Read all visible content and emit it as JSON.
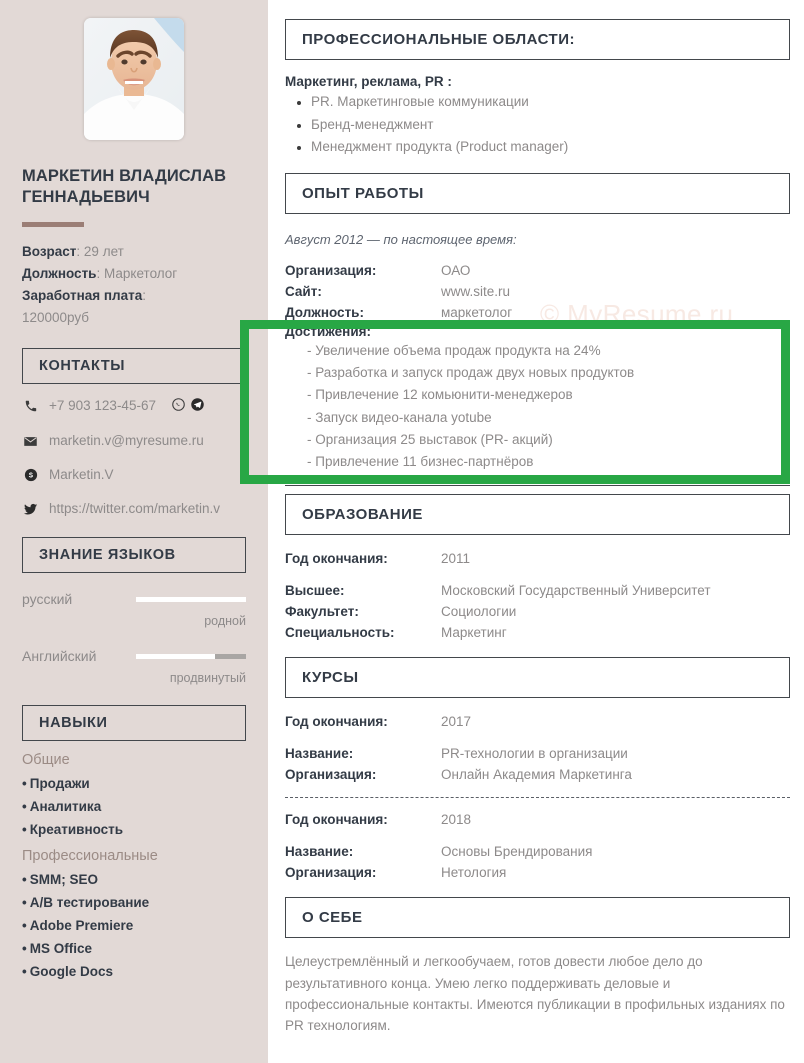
{
  "colors": {
    "sidebar_bg": "#e2d9d6",
    "ink": "#333b46",
    "muted": "#8d8a8a",
    "accent_rule": "#9b7e76",
    "highlight_green": "#28a745",
    "watermark": "#f7e9e3"
  },
  "watermark": "© MyResume.ru",
  "sidebar": {
    "photo": {
      "icon": "portrait-photo",
      "alt": "Фотография кандидата"
    },
    "name": "МАРКЕТИН ВЛАДИСЛАВ ГЕННАДЬЕВИЧ",
    "facts": [
      {
        "label": "Возраст",
        "value": "29 лет"
      },
      {
        "label": "Должность",
        "value": "Маркетолог"
      }
    ],
    "salary": {
      "label": "Заработная плата",
      "value": "120000руб"
    },
    "contacts": {
      "header": "КОНТАКТЫ",
      "items": [
        {
          "icon": "phone-icon",
          "text": "+7 903 123-45-67",
          "extra_icons": [
            "whatsapp-icon",
            "telegram-icon"
          ]
        },
        {
          "icon": "envelope-icon",
          "text": "marketin.v@myresume.ru",
          "extra_icons": []
        },
        {
          "icon": "skype-icon",
          "text": "Marketin.V",
          "extra_icons": []
        },
        {
          "icon": "twitter-icon",
          "text": "https://twitter.com/marketin.v",
          "extra_icons": []
        }
      ]
    },
    "languages": {
      "header": "ЗНАНИЕ ЯЗЫКОВ",
      "items": [
        {
          "name": "русский",
          "level": "родной",
          "percent": 100
        },
        {
          "name": "Английский",
          "level": "продвинутый",
          "percent": 72
        }
      ]
    },
    "skills": {
      "header": "НАВЫКИ",
      "groups": [
        {
          "title": "Общие",
          "items": [
            "Продажи",
            "Аналитика",
            "Креативность"
          ]
        },
        {
          "title": "Профессиональные",
          "items": [
            "SMM; SEO",
            "A/B тестирование",
            "Adobe Premiere",
            "MS Office",
            "Google Docs"
          ]
        }
      ]
    }
  },
  "main": {
    "prof_areas": {
      "header": "ПРОФЕССИОНАЛЬНЫЕ ОБЛАСТИ:",
      "subtitle": "Маркетинг, реклама, PR :",
      "items": [
        "PR. Маркетинговые коммуникации",
        "Бренд-менеджмент",
        "Менеджмент продукта (Product manager)"
      ]
    },
    "experience": {
      "header": "ОПЫТ РАБОТЫ",
      "period": "Август 2012 — по настоящее время:",
      "fields": [
        {
          "label": "Организация:",
          "value": "ОАО"
        },
        {
          "label": "Сайт:",
          "value": "www.site.ru"
        },
        {
          "label": "Должность:",
          "value": "маркетолог"
        }
      ],
      "achievements_label": "Достижения:",
      "achievements": [
        "- Увеличение объема продаж продукта на 24%",
        "- Разработка и запуск продаж двух новых продуктов",
        "- Привлечение 12 комьюнити-менеджеров",
        "- Запуск видео-канала yotube",
        "- Организация 25 выставок (PR- акций)",
        "- Привлечение 11 бизнес-партнёров"
      ]
    },
    "education": {
      "header": "ОБРАЗОВАНИЕ",
      "year": {
        "label": "Год окончания:",
        "value": "2011"
      },
      "fields": [
        {
          "label": "Высшее:",
          "value": "Московский Государственный Университет"
        },
        {
          "label": "Факультет:",
          "value": "Социологии"
        },
        {
          "label": "Специальность:",
          "value": "Маркетинг"
        }
      ]
    },
    "courses": {
      "header": "КУРСЫ",
      "entries": [
        {
          "year": {
            "label": "Год окончания:",
            "value": "2017"
          },
          "fields": [
            {
              "label": "Название:",
              "value": "PR-технологии в организации"
            },
            {
              "label": "Организация:",
              "value": "Онлайн Академия Маркетинга"
            }
          ]
        },
        {
          "year": {
            "label": "Год окончания:",
            "value": "2018"
          },
          "fields": [
            {
              "label": "Название:",
              "value": "Основы Брендирования"
            },
            {
              "label": "Организация:",
              "value": "Нетология"
            }
          ]
        }
      ]
    },
    "about": {
      "header": "О СЕБЕ",
      "text": "Целеустремлённый и легкообучаем, готов довести любое дело до результативного конца. Умею легко поддерживать деловые и профессиональные контакты. Имеются публикации в профильных изданиях по PR технологиям."
    }
  }
}
